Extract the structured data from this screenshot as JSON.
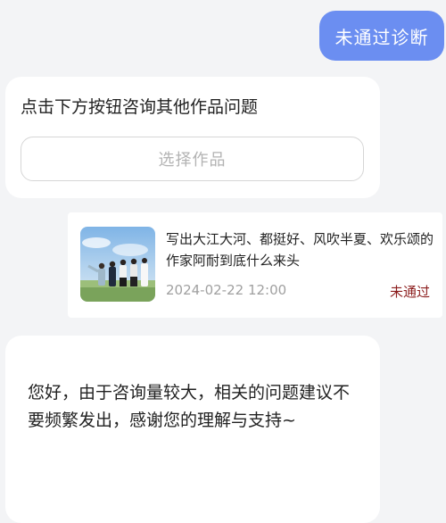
{
  "user_message": "未通过诊断",
  "consult_card": {
    "title": "点击下方按钮咨询其他作品问题",
    "button_label": "选择作品"
  },
  "work_card": {
    "title": "写出大江大河、都挺好、风吹半夏、欢乐颂的作家阿耐到底什么来头",
    "date": "2024-02-22 12:00",
    "status": "未通过"
  },
  "bot_reply": "您好，由于咨询量较大，相关的问题建议不要频繁发出，感谢您的理解与支持~",
  "colors": {
    "user_bubble": "#6b8ef1",
    "status_fail": "#8b1c1c",
    "background": "#f3f4f6"
  }
}
